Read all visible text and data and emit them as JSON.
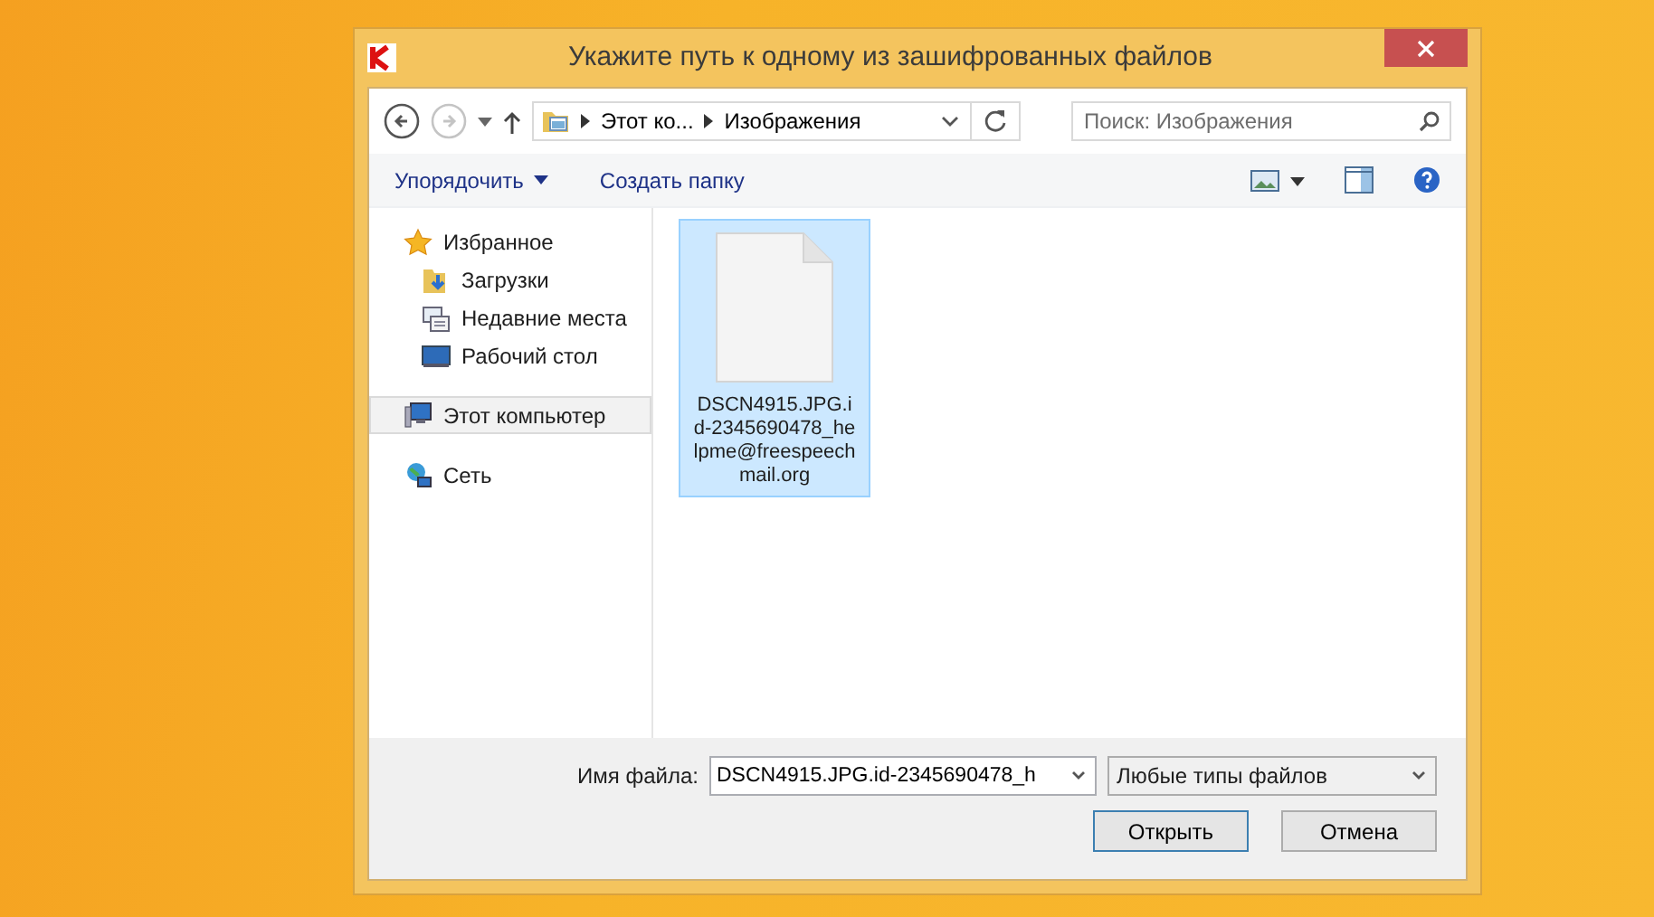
{
  "window": {
    "title": "Укажите путь к одному из зашифрованных файлов"
  },
  "navigation": {
    "back": {
      "disabled": false
    },
    "forward": {
      "disabled": true
    }
  },
  "breadcrumb": [
    "Этот ко...",
    "Изображения"
  ],
  "search": {
    "placeholder": "Поиск: Изображения"
  },
  "toolbar": {
    "organize": "Упорядочить",
    "new_folder": "Создать папку"
  },
  "sidebar": {
    "items": [
      {
        "label": "Избранное",
        "selected": false,
        "children": [
          {
            "label": "Загрузки",
            "selected": false
          },
          {
            "label": "Недавние места",
            "selected": false
          },
          {
            "label": "Рабочий стол",
            "selected": false
          }
        ]
      },
      {
        "label": "Этот компьютер",
        "selected": true
      },
      {
        "label": "Сеть",
        "selected": false
      }
    ]
  },
  "files": [
    {
      "name": "DSCN4915.JPG.id-2345690478_helpme@freespeechmail.org",
      "selected": true
    }
  ],
  "footer": {
    "filename_label": "Имя файла:",
    "filename_value": "DSCN4915.JPG.id-2345690478_h",
    "filetype": "Любые типы файлов",
    "buttons": [
      "Открыть",
      "Отмена"
    ]
  }
}
